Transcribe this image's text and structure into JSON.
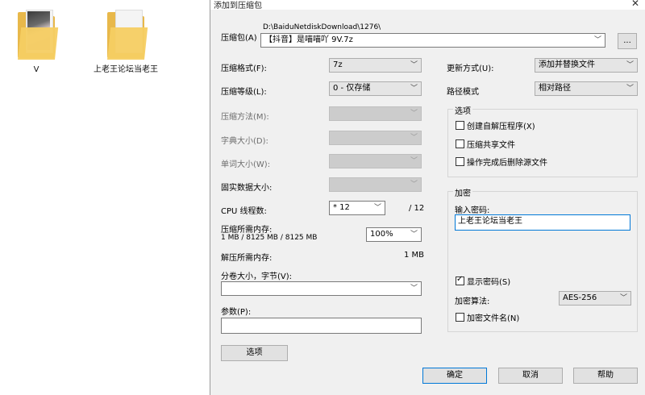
{
  "desktop": {
    "icons": [
      {
        "label": "V"
      },
      {
        "label": "上老王论坛当老王"
      }
    ]
  },
  "dialog": {
    "title": "添加到压缩包",
    "close_glyph": "✕",
    "archive": {
      "label": "压缩包(A)",
      "path": "D:\\BaiduNetdiskDownload\\1276\\",
      "name": "【抖音】是喵喵吖 9V.7z",
      "browse_label": "..."
    },
    "left": {
      "format_label": "压缩格式(F):",
      "format_value": "7z",
      "level_label": "压缩等级(L):",
      "level_value": "0 - 仅存储",
      "method_label": "压缩方法(M):",
      "dict_label": "字典大小(D):",
      "word_label": "单词大小(W):",
      "solid_label": "固实数据大小:",
      "cpu_label": "CPU 线程数:",
      "cpu_value": "* 12",
      "cpu_max": "/ 12",
      "mem_label": "压缩所需内存:",
      "mem_detail": "1 MB / 8125 MB / 8125 MB",
      "mem_percent": "100%",
      "decomp_label": "解压所需内存:",
      "decomp_value": "1 MB",
      "split_label": "分卷大小，字节(V):",
      "split_value": "",
      "params_label": "参数(P):",
      "params_value": "",
      "options_button": "选项"
    },
    "right": {
      "update_label": "更新方式(U):",
      "update_value": "添加并替换文件",
      "path_label": "路径模式",
      "path_value": "相对路径",
      "options_group": {
        "title": "选项",
        "items": [
          {
            "label": "创建自解压程序(X)",
            "checked": false
          },
          {
            "label": "压缩共享文件",
            "checked": false
          },
          {
            "label": "操作完成后删除源文件",
            "checked": false
          }
        ]
      },
      "encrypt_group": {
        "title": "加密",
        "password_label": "输入密码:",
        "password_value": "上老王论坛当老王",
        "show_password_label": "显示密码(S)",
        "show_password_checked": true,
        "algo_label": "加密算法:",
        "algo_value": "AES-256",
        "encrypt_names_label": "加密文件名(N)",
        "encrypt_names_checked": false
      }
    },
    "buttons": {
      "ok": "确定",
      "cancel": "取消",
      "help": "帮助"
    }
  }
}
